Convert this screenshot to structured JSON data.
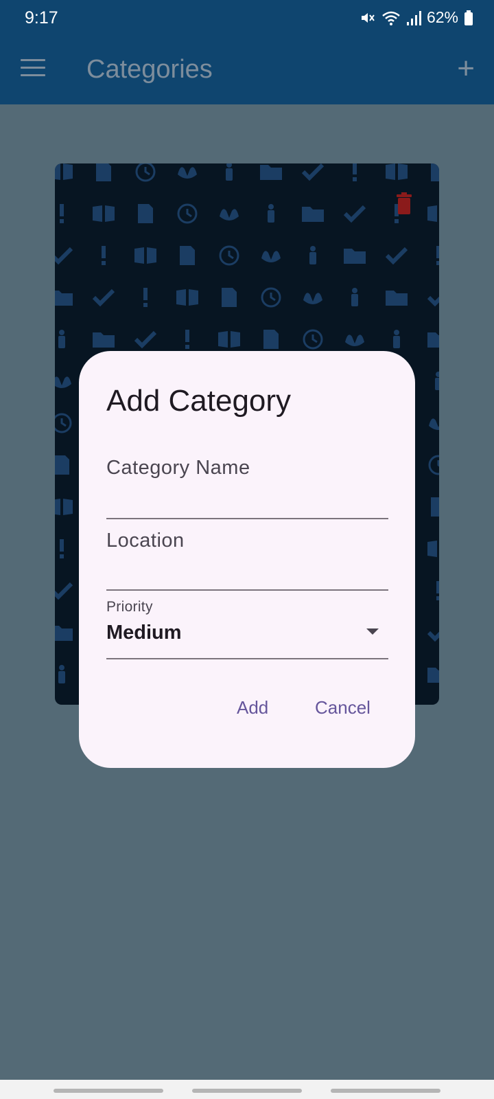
{
  "status_bar": {
    "time": "9:17",
    "battery": "62%",
    "icons": [
      "mute-icon",
      "wifi-icon",
      "signal-icon",
      "battery-icon"
    ]
  },
  "app_bar": {
    "title": "Categories",
    "menu_icon": "hamburger-menu-icon",
    "add_icon": "plus-icon"
  },
  "background_card": {
    "delete_icon": "trash-icon",
    "delete_color": "#8b1b1b",
    "pattern_color": "#1b3d63",
    "pattern_icons": [
      "book-icon",
      "exclamation-icon",
      "check-icon",
      "folder-icon",
      "person-icon",
      "hands-icon",
      "clock-icon",
      "document-icon"
    ]
  },
  "dialog": {
    "title": "Add Category",
    "category_name_placeholder": "Category Name",
    "location_placeholder": "Location",
    "priority_label": "Priority",
    "priority_value": "Medium",
    "add_label": "Add",
    "cancel_label": "Cancel"
  },
  "colors": {
    "app_bar": "#0f456f",
    "scrim": "#546a76",
    "dialog_bg": "#fbf3fb",
    "accent": "#65559b"
  }
}
